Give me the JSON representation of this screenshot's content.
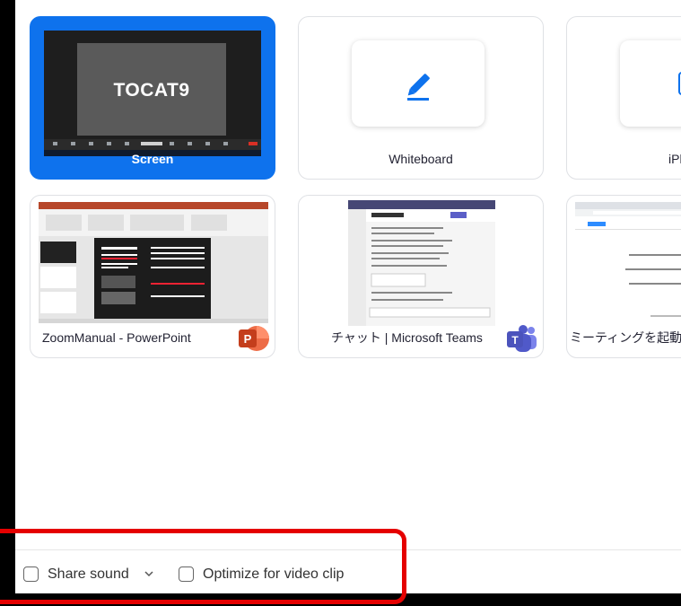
{
  "share_tiles": [
    {
      "label": "Screen",
      "preview_text": "TOCAT9",
      "selected": true
    },
    {
      "label": "Whiteboard",
      "icon": "pen-icon"
    },
    {
      "label": "iPhor"
    },
    {
      "label": "ZoomManual - PowerPoint",
      "app_badge": "P"
    },
    {
      "label": "チャット | Microsoft Teams",
      "app_badge": "T"
    },
    {
      "label": "ミーティングを起動 -"
    }
  ],
  "options": {
    "share_sound": "Share sound",
    "optimize_video": "Optimize for video clip",
    "share_sound_checked": false,
    "optimize_checked": false
  },
  "colors": {
    "selected_accent": "#0e72ed",
    "highlight": "#e50000",
    "powerpoint": "#d24726",
    "teams": "#5059c9"
  }
}
